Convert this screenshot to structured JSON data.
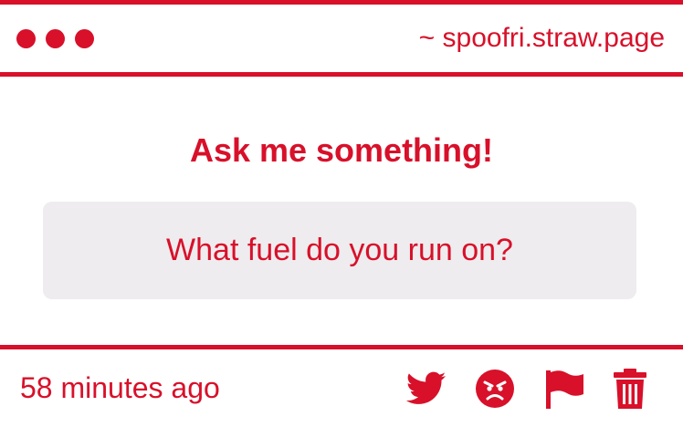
{
  "window": {
    "url": "~ spoofri.straw.page"
  },
  "main": {
    "title": "Ask me something!",
    "question": "What fuel do you run on?"
  },
  "footer": {
    "timestamp": "58 minutes ago",
    "actions": [
      {
        "icon": "twitter-icon"
      },
      {
        "icon": "angry-face-icon"
      },
      {
        "icon": "flag-icon"
      },
      {
        "icon": "trash-icon"
      }
    ]
  },
  "colors": {
    "accent": "#d8102a",
    "question_bg": "#eeecee",
    "background": "#ffffff"
  }
}
